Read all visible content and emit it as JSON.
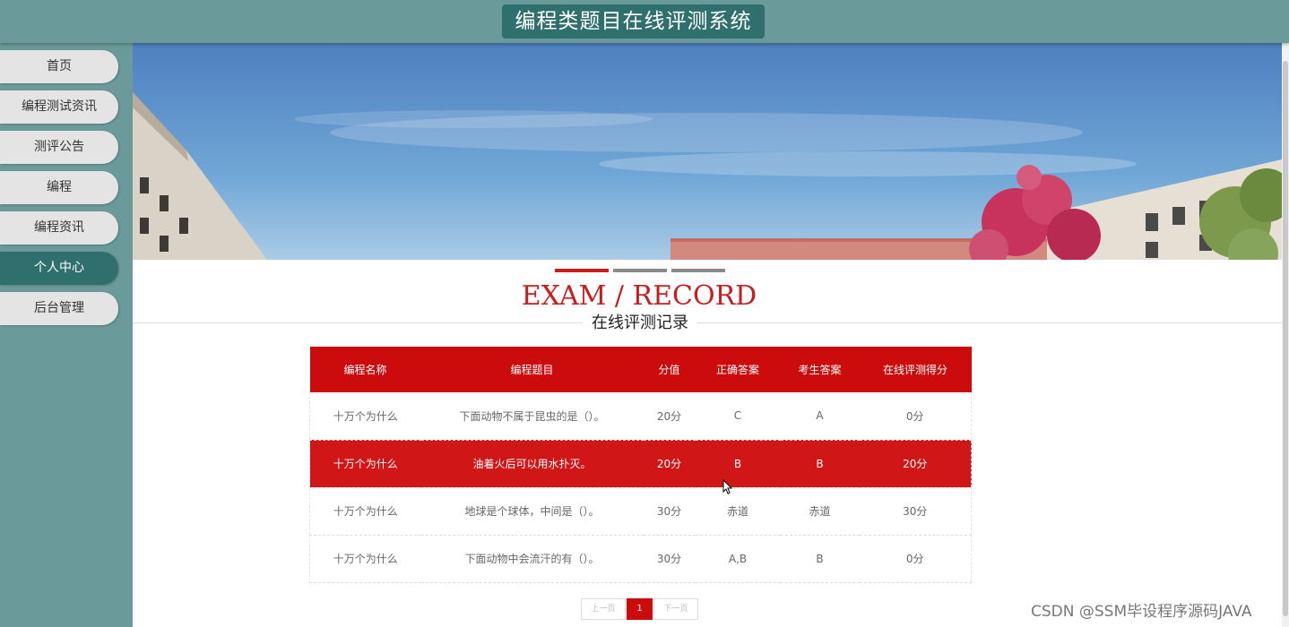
{
  "header": {
    "site_title": "编程类题目在线评测系统"
  },
  "sidebar": {
    "items": [
      {
        "label": "首页"
      },
      {
        "label": "编程测试资讯"
      },
      {
        "label": "测评公告"
      },
      {
        "label": "编程"
      },
      {
        "label": "编程资讯"
      },
      {
        "label": "个人中心",
        "active": true
      },
      {
        "label": "后台管理"
      }
    ]
  },
  "carousel": {
    "indicator_count": 3,
    "active_index": 0
  },
  "section": {
    "title_en": "EXAM / RECORD",
    "title_cn": "在线评测记录"
  },
  "table": {
    "headers": [
      "编程名称",
      "编程题目",
      "分值",
      "正确答案",
      "考生答案",
      "在线评测得分"
    ],
    "rows": [
      {
        "cells": [
          "十万个为什么",
          "下面动物不属于昆虫的是（）。",
          "20分",
          "C",
          "A",
          "0分"
        ]
      },
      {
        "cells": [
          "十万个为什么",
          "油着火后可以用水扑灭。",
          "20分",
          "B",
          "B",
          "20分"
        ],
        "highlighted": true
      },
      {
        "cells": [
          "十万个为什么",
          "地球是个球体，中间是（）。",
          "30分",
          "赤道",
          "赤道",
          "30分"
        ]
      },
      {
        "cells": [
          "十万个为什么",
          "下面动物中会流汗的有（）。",
          "30分",
          "A,B",
          "B",
          "0分"
        ]
      }
    ]
  },
  "pagination": {
    "prev_label": "上一页",
    "current_page": "1",
    "next_label": "下一页"
  },
  "watermark": "CSDN @SSM毕设程序源码JAVA",
  "colors": {
    "accent_red": "#cc0c0c",
    "teal": "#6a9a99",
    "teal_dark": "#2f6f6d"
  }
}
